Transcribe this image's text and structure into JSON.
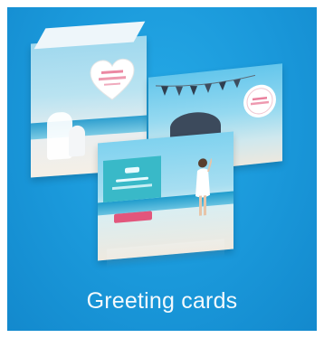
{
  "tile": {
    "label": "Greeting cards",
    "background_color": "#1a98da",
    "label_color": "#ffffff"
  },
  "illustration": {
    "icon": "greeting-cards-illustration",
    "cards": [
      "left-card",
      "right-card",
      "front-card"
    ],
    "accent_pink": "#e2567c",
    "panel_teal": "#39b9c8"
  }
}
